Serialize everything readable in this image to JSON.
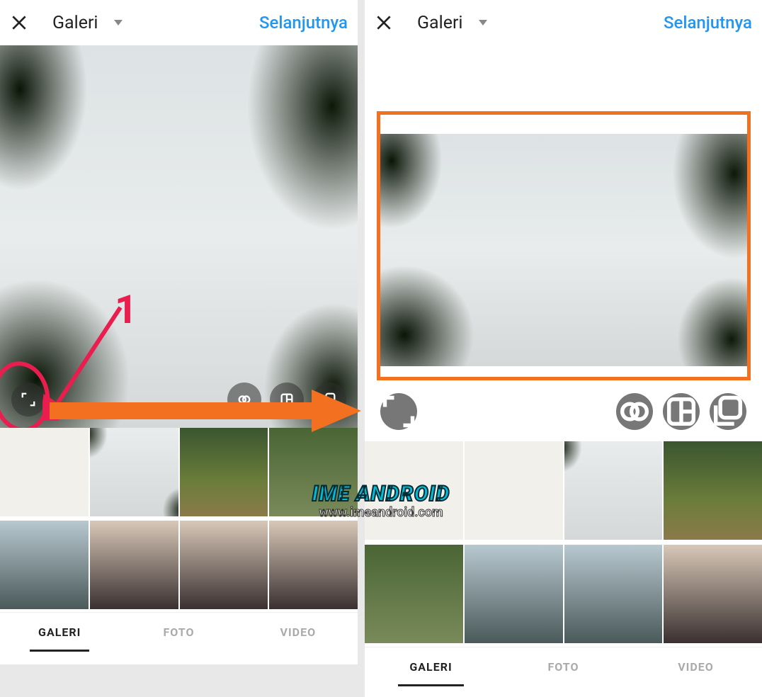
{
  "left": {
    "topbar": {
      "title": "Galeri",
      "next": "Selanjutnya"
    },
    "tabs": {
      "gallery": "GALERI",
      "photo": "FOTO",
      "video": "VIDEO",
      "active": "gallery"
    }
  },
  "right": {
    "topbar": {
      "title": "Galeri",
      "next": "Selanjutnya"
    },
    "tabs": {
      "gallery": "GALERI",
      "photo": "FOTO",
      "video": "VIDEO",
      "active": "gallery"
    }
  },
  "annotation": {
    "step_label": "1"
  },
  "watermark": {
    "line1": "IME ANDROID",
    "line2": "www.imeandroid.com"
  }
}
